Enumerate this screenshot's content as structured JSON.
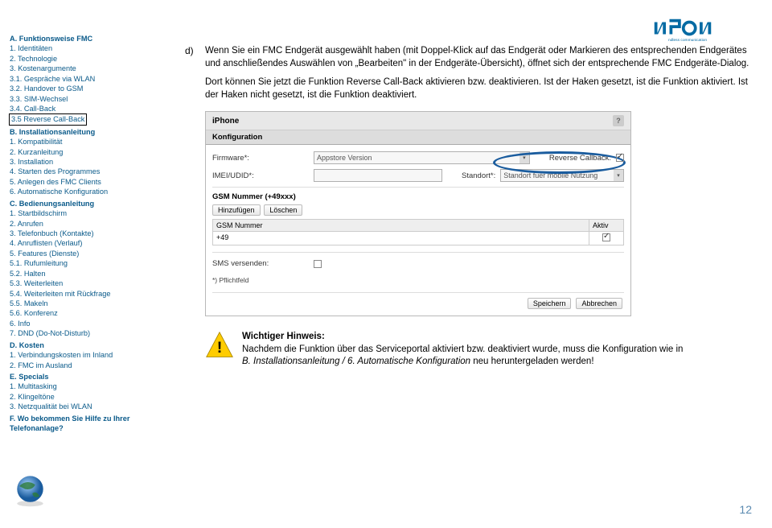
{
  "logo": {
    "text": "nfon",
    "tagline": "ndless communication"
  },
  "pageNumber": "12",
  "bulletLabel": "d)",
  "paragraphs": {
    "p1": "Wenn Sie ein FMC Endgerät ausgewählt haben (mit Doppel-Klick auf das Endgerät oder Markieren des entsprechenden Endgerätes und anschließendes Auswählen von „Bearbeiten\" in der Endgeräte-Übersicht), öffnet sich der entsprechende FMC Endgeräte-Dialog.",
    "p2": "Dort können Sie jetzt die Funktion Reverse Call-Back aktivieren bzw. deaktivieren. Ist der Haken gesetzt, ist die Funktion aktiviert. Ist der Haken nicht gesetzt, ist die Funktion deaktiviert."
  },
  "configShot": {
    "windowTitle": "iPhone",
    "closeSymbol": "?",
    "tab": "Konfiguration",
    "firmwareLabel": "Firmware*:",
    "firmwareValue": "Appstore Version",
    "reverseCallbackLabel": "Reverse Callback:",
    "imeiLabel": "IMEI/UDID*:",
    "standortLabel": "Standort*:",
    "standortValue": "Standort fuer mobile Nutzung",
    "gsmHeader": "GSM Nummer (+49xxx)",
    "addBtn": "Hinzufügen",
    "delBtn": "Löschen",
    "colGsm": "GSM Nummer",
    "colAktiv": "Aktiv",
    "gsmValue": "+49",
    "smsLabel": "SMS versenden:",
    "footnote": "*) Pflichtfeld",
    "saveBtn": "Speichern",
    "cancelBtn": "Abbrechen"
  },
  "warning": {
    "heading": "Wichtiger Hinweis:",
    "line1_a": "Nachdem die Funktion über das Serviceportal aktiviert bzw. deaktiviert wurde, muss die Konfiguration wie in",
    "line1_b": "B. Installationsanleitung / 6. Automatische Konfiguration",
    "line1_c": " neu heruntergeladen werden!"
  },
  "toc": {
    "a_head": "A. Funktionsweise FMC",
    "a1": "1. Identitäten",
    "a2": "2. Technologie",
    "a3": "3. Kostenargumente",
    "a31": "3.1. Gespräche via WLAN",
    "a32": "3.2. Handover to GSM",
    "a33": "3.3. SIM-Wechsel",
    "a34": "3.4. Call-Back",
    "a35": "3.5 Reverse Call-Back",
    "b_head": "B. Installationsanleitung",
    "b1": "1. Kompatibilität",
    "b2": "2. Kurzanleitung",
    "b3": "3. Installation",
    "b4": "4. Starten des Programmes",
    "b5": "5. Anlegen des FMC Clients",
    "b6": "6. Automatische Konfiguration",
    "c_head": "C. Bedienungsanleitung",
    "c1": "1. Startbildschirm",
    "c2": "2. Anrufen",
    "c3": "3. Telefonbuch (Kontakte)",
    "c4": "4. Anruflisten (Verlauf)",
    "c5": "5. Features (Dienste)",
    "c51": "5.1. Rufumleitung",
    "c52": "5.2. Halten",
    "c53": "5.3. Weiterleiten",
    "c54": "5.4. Weiterleiten mit Rückfrage",
    "c55": "5.5. Makeln",
    "c56": "5.6. Konferenz",
    "c6": "6. Info",
    "c7": "7. DND (Do-Not-Disturb)",
    "d_head": "D. Kosten",
    "d1": "1. Verbindungskosten im Inland",
    "d2": "2. FMC im Ausland",
    "e_head": "E. Specials",
    "e1": "1. Multitasking",
    "e2": "2. Klingeltöne",
    "e3": "3. Netzqualität bei WLAN",
    "f_head": "F. Wo bekommen Sie Hilfe zu Ihrer Telefonanlage?"
  }
}
